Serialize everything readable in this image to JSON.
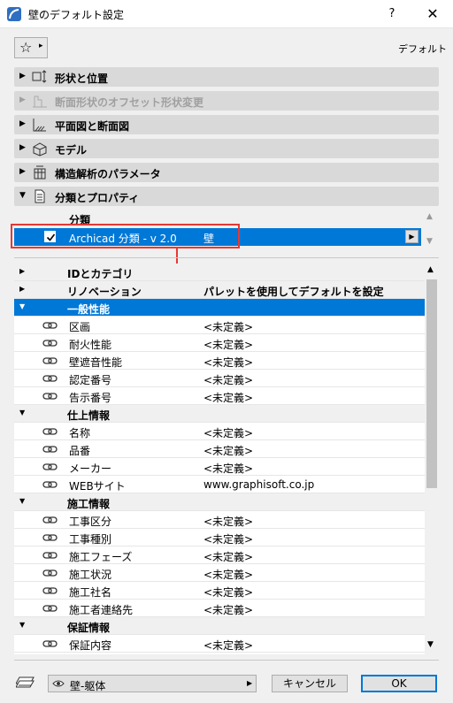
{
  "window": {
    "title": "壁のデフォルト設定",
    "help": "?",
    "close": "✕"
  },
  "favorites": {
    "star": "☆",
    "arrow": "▸",
    "default_label": "デフォルト"
  },
  "sections": [
    {
      "label": "形状と位置",
      "disabled": false,
      "icon": "shape-position-icon"
    },
    {
      "label": "断面形状のオフセット形状変更",
      "disabled": true,
      "icon": "offset-profile-icon"
    },
    {
      "label": "平面図と断面図",
      "disabled": false,
      "icon": "floorplan-section-icon"
    },
    {
      "label": "モデル",
      "disabled": false,
      "icon": "model-icon"
    },
    {
      "label": "構造解析のパラメータ",
      "disabled": false,
      "icon": "structural-analysis-icon"
    },
    {
      "label": "分類とプロパティ",
      "disabled": false,
      "icon": "classification-icon"
    }
  ],
  "section_arrows": {
    "collapsed": "▶",
    "expanded": "▼"
  },
  "classification": {
    "header": "分類",
    "name": "Archicad 分類 - v 2.0",
    "value": "壁",
    "more": "▶"
  },
  "properties": {
    "rows": [
      {
        "type": "top",
        "label": "IDとカテゴリ",
        "value": ""
      },
      {
        "type": "top",
        "label": "リノベーション",
        "value": "パレットを使用してデフォルトを設定"
      },
      {
        "type": "group-selected",
        "label": "一般性能",
        "value": ""
      },
      {
        "type": "prop",
        "label": "区画",
        "value": "<未定義>"
      },
      {
        "type": "prop",
        "label": "耐火性能",
        "value": "<未定義>"
      },
      {
        "type": "prop",
        "label": "壁遮音性能",
        "value": "<未定義>"
      },
      {
        "type": "prop",
        "label": "認定番号",
        "value": "<未定義>"
      },
      {
        "type": "prop",
        "label": "告示番号",
        "value": "<未定義>"
      },
      {
        "type": "group",
        "label": "仕上情報",
        "value": ""
      },
      {
        "type": "prop",
        "label": "名称",
        "value": "<未定義>"
      },
      {
        "type": "prop",
        "label": "品番",
        "value": "<未定義>"
      },
      {
        "type": "prop",
        "label": "メーカー",
        "value": "<未定義>"
      },
      {
        "type": "prop",
        "label": "WEBサイト",
        "value": "www.graphisoft.co.jp"
      },
      {
        "type": "group",
        "label": "施工情報",
        "value": ""
      },
      {
        "type": "prop",
        "label": "工事区分",
        "value": "<未定義>"
      },
      {
        "type": "prop",
        "label": "工事種別",
        "value": "<未定義>"
      },
      {
        "type": "prop",
        "label": "施工フェーズ",
        "value": "<未定義>"
      },
      {
        "type": "prop",
        "label": "施工状況",
        "value": "<未定義>"
      },
      {
        "type": "prop",
        "label": "施工社名",
        "value": "<未定義>"
      },
      {
        "type": "prop",
        "label": "施工者連絡先",
        "value": "<未定義>"
      },
      {
        "type": "group",
        "label": "保証情報",
        "value": ""
      },
      {
        "type": "prop",
        "label": "保証内容",
        "value": "<未定義>"
      }
    ]
  },
  "footer": {
    "layer": "壁-躯体",
    "layer_arrow": "▶",
    "cancel": "キャンセル",
    "ok": "OK"
  },
  "colors": {
    "selection": "#0078d7",
    "highlight": "#e53935"
  }
}
